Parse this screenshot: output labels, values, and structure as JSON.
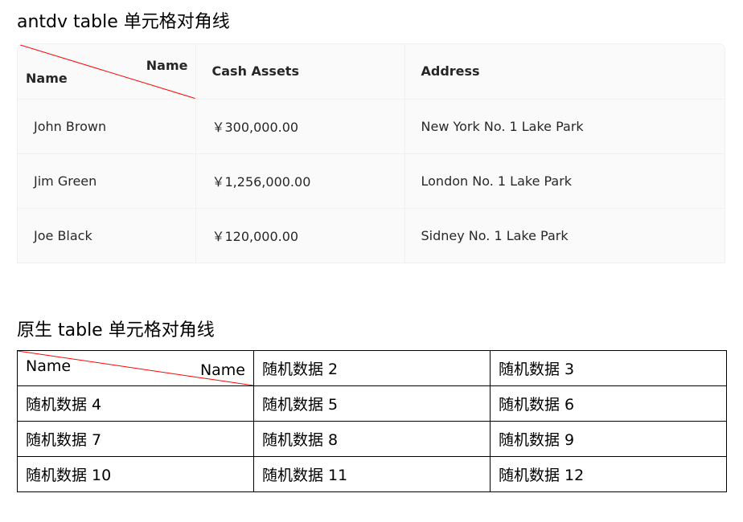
{
  "antd_section": {
    "title": "antdv table 单元格对角线",
    "header": {
      "diag_top": "Name",
      "diag_bottom": "Name",
      "col2": "Cash Assets",
      "col3": "Address"
    },
    "rows": [
      {
        "name": "John Brown",
        "money": "￥300,000.00",
        "address": "New York No. 1 Lake Park"
      },
      {
        "name": "Jim Green",
        "money": "￥1,256,000.00",
        "address": "London No. 1 Lake Park"
      },
      {
        "name": "Joe Black",
        "money": "￥120,000.00",
        "address": "Sidney No. 1 Lake Park"
      }
    ]
  },
  "native_section": {
    "title": "原生 table 单元格对角线",
    "diag_top": "Name",
    "diag_bottom": "Name",
    "cells": [
      [
        "",
        "随机数据 2",
        "随机数据 3"
      ],
      [
        "随机数据 4",
        "随机数据 5",
        "随机数据 6"
      ],
      [
        "随机数据 7",
        "随机数据 8",
        "随机数据 9"
      ],
      [
        "随机数据 10",
        "随机数据 11",
        "随机数据 12"
      ]
    ]
  },
  "colors": {
    "diagonal": "#ff0000",
    "header_bg": "#fafafa",
    "border": "#f0f0f0"
  }
}
